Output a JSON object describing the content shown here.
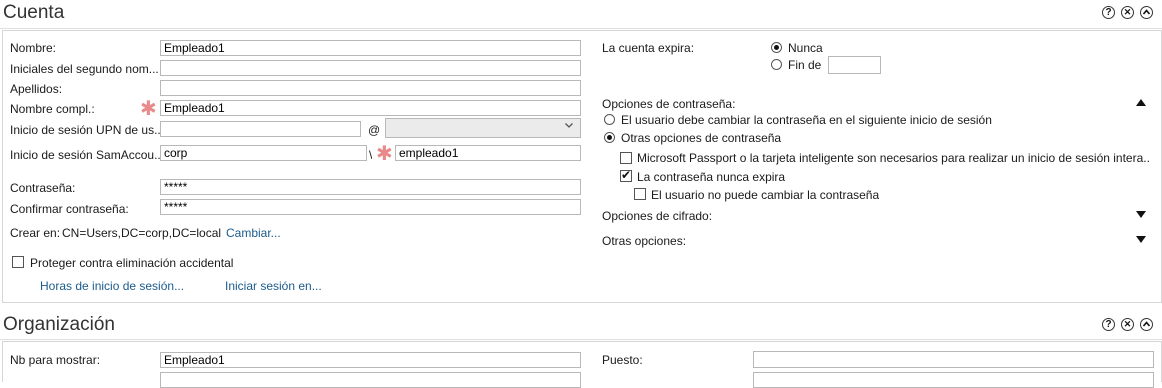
{
  "cuenta": {
    "title": "Cuenta",
    "nombre_label": "Nombre:",
    "nombre_value": "Empleado1",
    "iniciales_label": "Iniciales del segundo nom...",
    "iniciales_value": "",
    "apellidos_label": "Apellidos:",
    "apellidos_value": "",
    "nombre_compl_label": "Nombre compl.:",
    "nombre_compl_value": "Empleado1",
    "upn_label": "Inicio de sesión UPN de us...",
    "upn_value": "",
    "upn_at": "@",
    "upn_domain": "",
    "sam_label": "Inicio de sesión SamAccou...",
    "sam_domain": "corp",
    "sam_sep": "\\",
    "sam_user": "empleado1",
    "password_label": "Contraseña:",
    "password_value": "*****",
    "confirm_label": "Confirmar contraseña:",
    "confirm_value": "*****",
    "crear_en_label": "Crear en:",
    "crear_en_value": "CN=Users,DC=corp,DC=local",
    "cambiar_link": "Cambiar...",
    "proteger_label": "Proteger contra eliminación accidental",
    "proteger_checked": false,
    "horas_link": "Horas de inicio de sesión...",
    "iniciar_link": "Iniciar sesión en...",
    "expira_label": "La cuenta expira:",
    "nunca_label": "Nunca",
    "nunca_selected": true,
    "fin_de_label": "Fin de",
    "fin_de_value": "",
    "pwd_options_label": "Opciones de contraseña:",
    "pwd_opt_change": "El usuario debe cambiar la contraseña en el siguiente inicio de sesión",
    "pwd_opt_other": "Otras opciones de contraseña",
    "pwd_other_selected": true,
    "passport_label": "Microsoft Passport o la tarjeta inteligente son necesarios para realizar un inicio de sesión intera...",
    "passport_checked": false,
    "never_expires_label": "La contraseña nunca expira",
    "never_expires_checked": true,
    "cannot_change_label": "El usuario no puede cambiar la contraseña",
    "cannot_change_checked": false,
    "cifrado_label": "Opciones de cifrado:",
    "otras_label": "Otras opciones:"
  },
  "organizacion": {
    "title": "Organización",
    "nb_label": "Nb para mostrar:",
    "nb_value": "Empleado1",
    "puesto_label": "Puesto:",
    "puesto_value": ""
  },
  "controls": {
    "help": "?",
    "close": "✕",
    "collapse": "^"
  }
}
